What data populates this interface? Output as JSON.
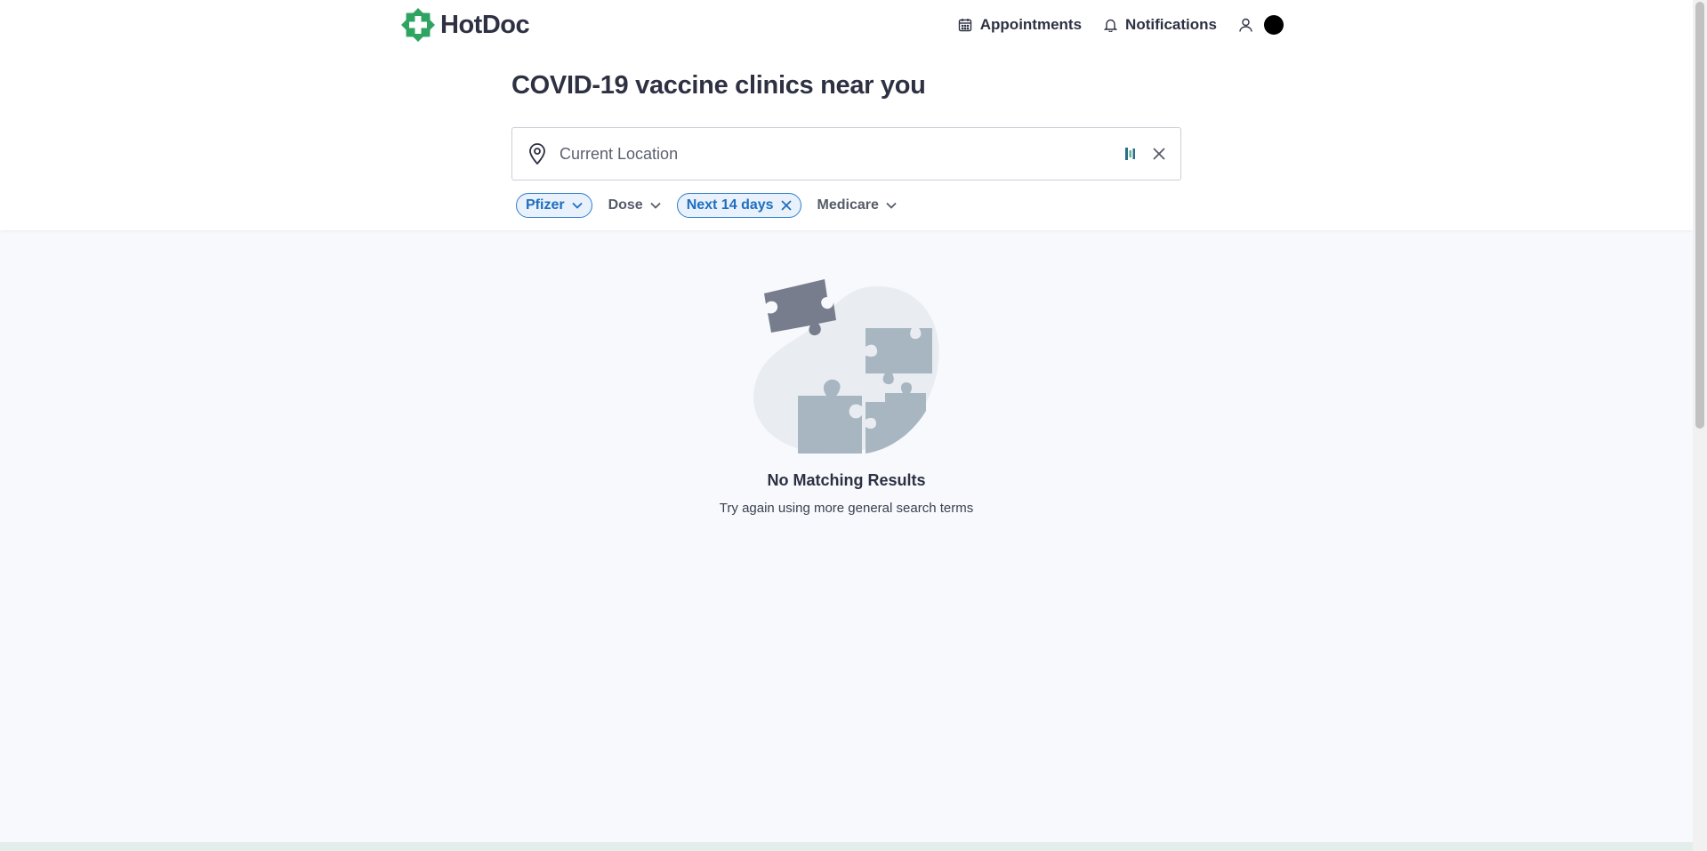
{
  "brand": {
    "name": "HotDoc",
    "color": "#2fa462"
  },
  "nav": {
    "appointments": "Appointments",
    "notifications": "Notifications"
  },
  "page": {
    "title": "COVID-19 vaccine clinics near you"
  },
  "search": {
    "placeholder": "Current Location",
    "value": ""
  },
  "filters": [
    {
      "label": "Pfizer",
      "active": true,
      "control": "dropdown"
    },
    {
      "label": "Dose",
      "active": false,
      "control": "dropdown"
    },
    {
      "label": "Next 14 days",
      "active": true,
      "control": "clear"
    },
    {
      "label": "Medicare",
      "active": false,
      "control": "dropdown"
    }
  ],
  "empty_state": {
    "title": "No Matching Results",
    "subtitle": "Try again using more general search terms"
  },
  "icons": {
    "logo": "medical-cross-icon",
    "appointments": "calendar-icon",
    "notifications": "bell-icon",
    "user": "user-icon",
    "search": "location-pin-icon",
    "detect": "locate-icon",
    "clear": "close-icon",
    "dropdown": "chevron-down-icon",
    "empty": "puzzle-illustration"
  },
  "colors": {
    "accent": "#1f6ebf",
    "chip_bg": "#e8f1fc",
    "text": "#2d3142",
    "background": "#f7f9fc"
  }
}
